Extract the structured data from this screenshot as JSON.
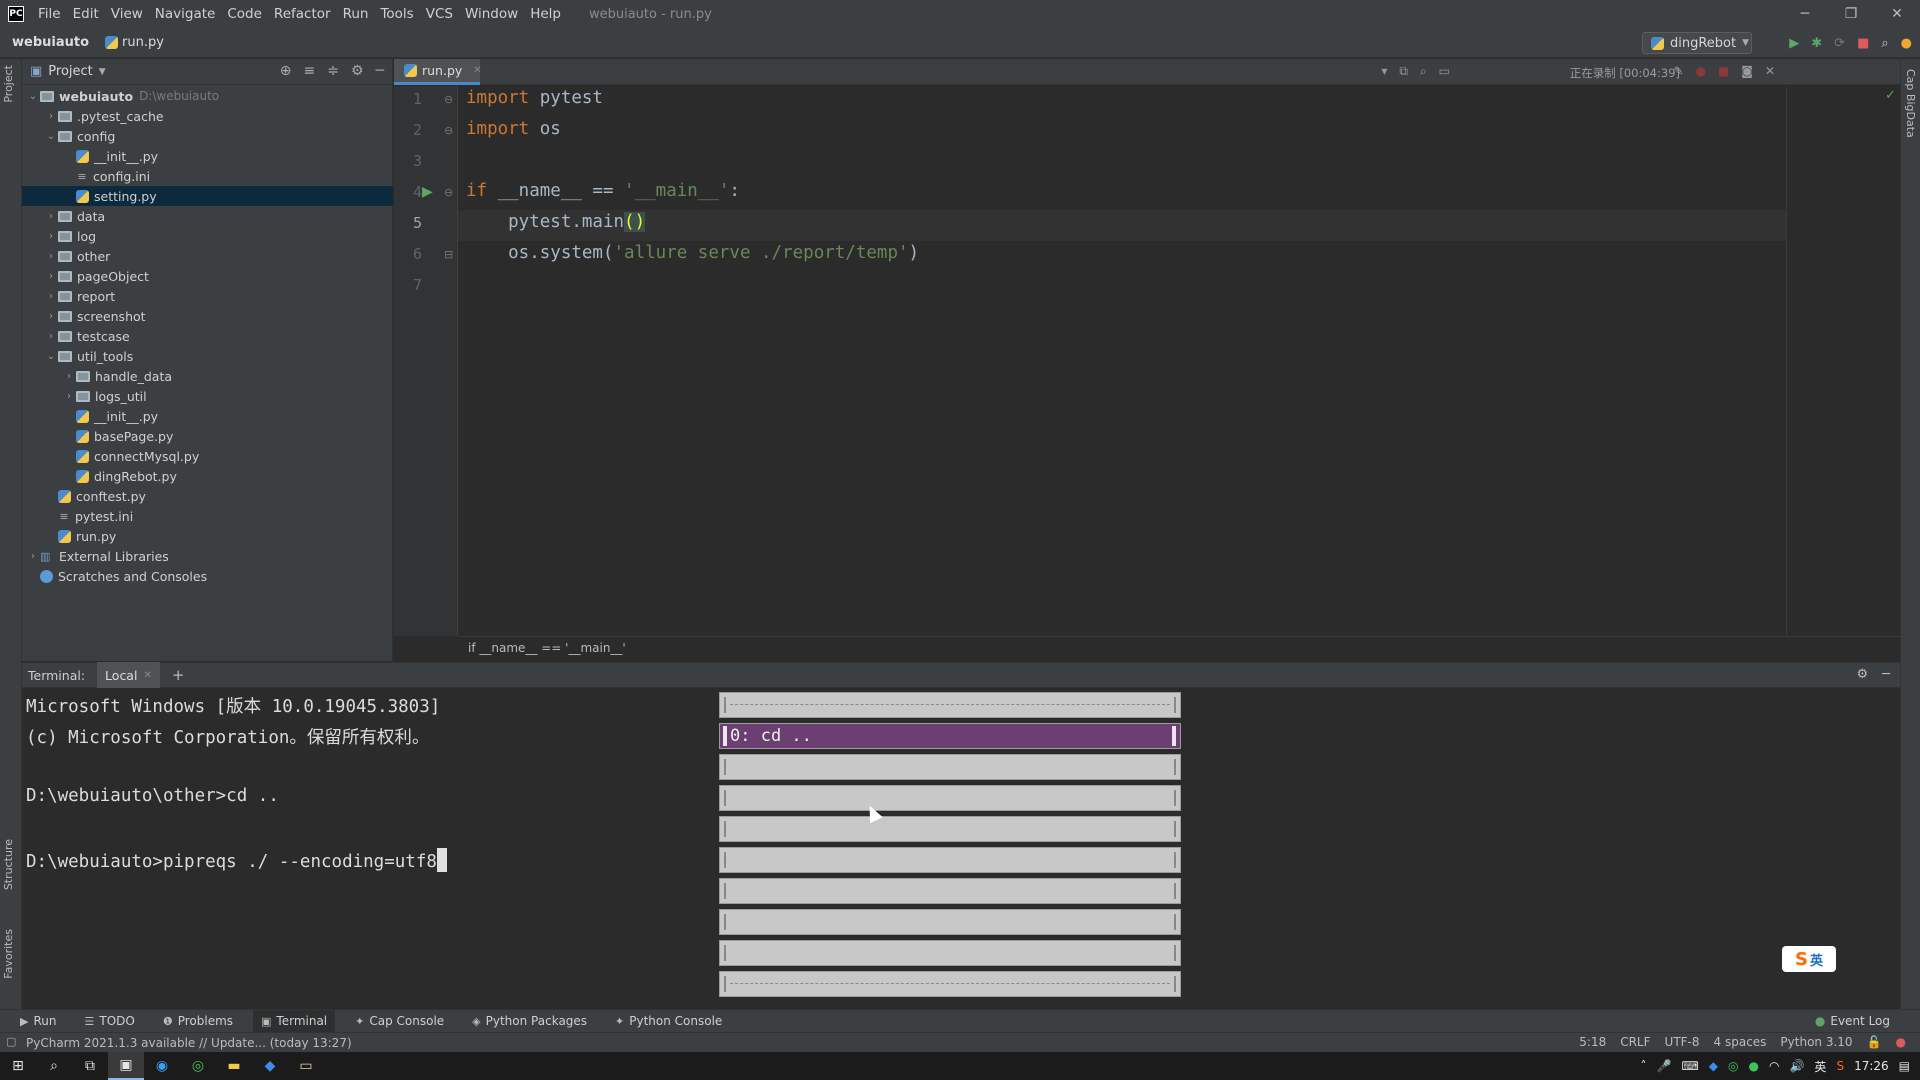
{
  "app": {
    "logo": "PC",
    "window_title": "webuiauto - run.py",
    "menu": [
      "File",
      "Edit",
      "View",
      "Navigate",
      "Code",
      "Refactor",
      "Run",
      "Tools",
      "VCS",
      "Window",
      "Help"
    ]
  },
  "navbar": {
    "project": "webuiauto",
    "file": "run.py",
    "run_config": "dingRebot"
  },
  "project_panel": {
    "title": "Project",
    "tree": [
      {
        "label": "webuiauto",
        "path": "D:\\webuiauto",
        "type": "folder",
        "depth": 0,
        "expanded": true,
        "bold": true
      },
      {
        "label": ".pytest_cache",
        "type": "folder",
        "depth": 1,
        "expanded": false
      },
      {
        "label": "config",
        "type": "folder",
        "depth": 1,
        "expanded": true
      },
      {
        "label": "__init__.py",
        "type": "py",
        "depth": 2
      },
      {
        "label": "config.ini",
        "type": "ini",
        "depth": 2
      },
      {
        "label": "setting.py",
        "type": "py",
        "depth": 2,
        "selected": true
      },
      {
        "label": "data",
        "type": "folder",
        "depth": 1,
        "expanded": false
      },
      {
        "label": "log",
        "type": "folder",
        "depth": 1,
        "expanded": false
      },
      {
        "label": "other",
        "type": "folder",
        "depth": 1,
        "expanded": false
      },
      {
        "label": "pageObject",
        "type": "folder",
        "depth": 1,
        "expanded": false
      },
      {
        "label": "report",
        "type": "folder",
        "depth": 1,
        "expanded": false
      },
      {
        "label": "screenshot",
        "type": "folder",
        "depth": 1,
        "expanded": false
      },
      {
        "label": "testcase",
        "type": "folder",
        "depth": 1,
        "expanded": false
      },
      {
        "label": "util_tools",
        "type": "folder",
        "depth": 1,
        "expanded": true
      },
      {
        "label": "handle_data",
        "type": "folder",
        "depth": 2,
        "expanded": false
      },
      {
        "label": "logs_util",
        "type": "folder",
        "depth": 2,
        "expanded": false
      },
      {
        "label": "__init__.py",
        "type": "py",
        "depth": 2
      },
      {
        "label": "basePage.py",
        "type": "py",
        "depth": 2
      },
      {
        "label": "connectMysql.py",
        "type": "py",
        "depth": 2
      },
      {
        "label": "dingRebot.py",
        "type": "py",
        "depth": 2
      },
      {
        "label": "conftest.py",
        "type": "py",
        "depth": 1
      },
      {
        "label": "pytest.ini",
        "type": "ini",
        "depth": 1
      },
      {
        "label": "run.py",
        "type": "py",
        "depth": 1
      },
      {
        "label": "External Libraries",
        "type": "lib",
        "depth": 0,
        "expanded": false
      },
      {
        "label": "Scratches and Consoles",
        "type": "scratch",
        "depth": 0
      }
    ]
  },
  "editor": {
    "tab": "run.py",
    "recording": "正在录制 [00:04:39]",
    "line_numbers": [
      "1",
      "2",
      "3",
      "4",
      "5",
      "6",
      "7"
    ],
    "current_line": 5,
    "breadcrumb": "if __name__ == '__main__'"
  },
  "terminal": {
    "label": "Terminal:",
    "tab": "Local",
    "lines": [
      "Microsoft Windows [版本 10.0.19045.3803]",
      "(c) Microsoft Corporation。保留所有权利。",
      "",
      "D:\\webuiauto\\other>cd ..",
      "",
      "D:\\webuiauto>pipreqs ./ --encoding=utf8"
    ]
  },
  "popup": {
    "selected_item": "0: cd .."
  },
  "ime": {
    "s": "S",
    "t": "英"
  },
  "bottom_tools": [
    "Run",
    "TODO",
    "Problems",
    "Terminal",
    "Cap Console",
    "Python Packages",
    "Python Console"
  ],
  "active_bottom_tool": "Terminal",
  "event_log": "Event Log",
  "status": {
    "message": "PyCharm 2021.1.3 available // Update... (today 13:27)",
    "position": "5:18",
    "line_sep": "CRLF",
    "encoding": "UTF-8",
    "indent": "4 spaces",
    "interpreter": "Python 3.10"
  },
  "taskbar": {
    "ime": "英",
    "time": "17:26"
  },
  "side_tabs": {
    "project": "Project",
    "structure": "Structure",
    "favorites": "Favorites",
    "right": "Cap BigData"
  }
}
